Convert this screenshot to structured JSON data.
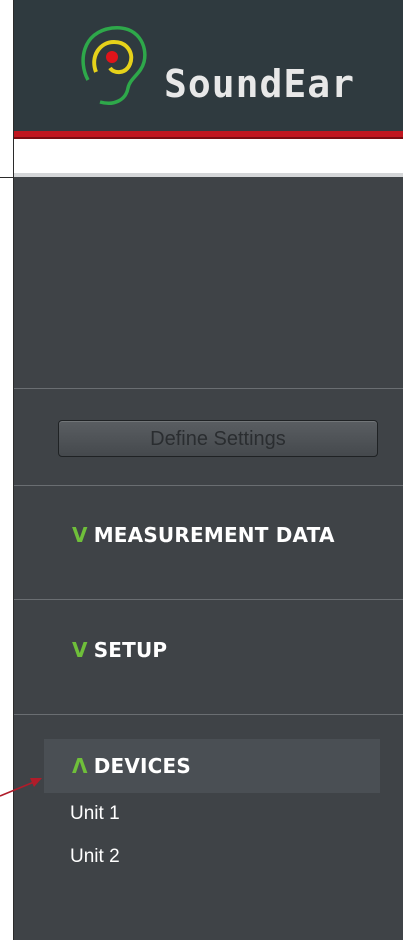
{
  "brand": {
    "name": "SoundEar",
    "logo_icon": "ear-icon",
    "accent_red": "#c0161f",
    "accent_green": "#6fbf3a"
  },
  "actions": {
    "define_settings_label": "Define Settings"
  },
  "sections": [
    {
      "label": "MEASUREMENT DATA",
      "chevron": "V",
      "expanded": false
    },
    {
      "label": "SETUP",
      "chevron": "V",
      "expanded": false
    },
    {
      "label": "DEVICES",
      "chevron": "Λ",
      "expanded": true
    }
  ],
  "devices": [
    "Unit 1",
    "Unit 2"
  ]
}
